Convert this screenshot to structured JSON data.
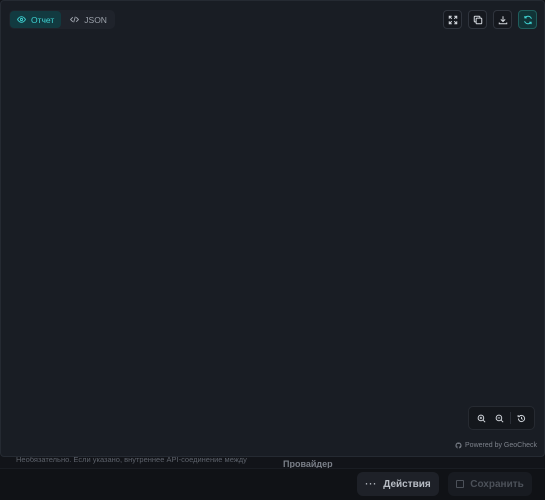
{
  "tabs": [
    {
      "label": "Отчет",
      "active": true
    },
    {
      "label": "JSON",
      "active": false
    }
  ],
  "toolbar": {
    "icons": [
      "fullscreen-icon",
      "copy-icon",
      "download-icon",
      "refresh-icon"
    ]
  },
  "zoom": {
    "icons": [
      "zoom-in-icon",
      "zoom-out-icon",
      "reset-icon"
    ]
  },
  "footer": {
    "powered_by": "Powered by GeoCheck"
  },
  "background": {
    "helper_text": "Необязательно. Если указано, внутреннее API-соединение между",
    "section_heading": "Провайдер",
    "actions_label": "Действия",
    "save_label": "Сохранить"
  },
  "colors": {
    "accent": "#3fd2d2",
    "panel_bg": "#191d24",
    "page_bg": "#121419"
  }
}
